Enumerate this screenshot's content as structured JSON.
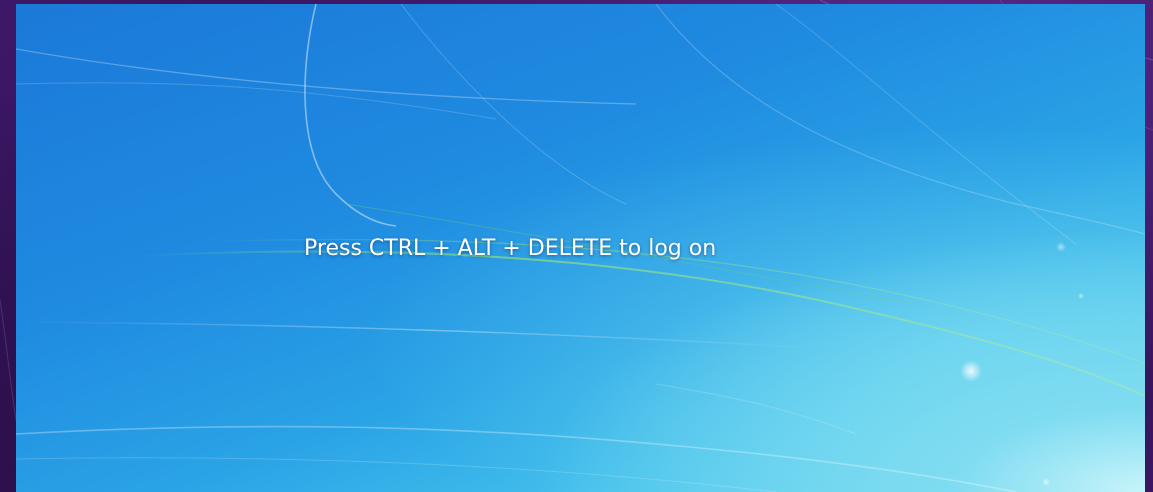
{
  "logon": {
    "prompt": "Press CTRL + ALT + DELETE to log on"
  },
  "colors": {
    "outer_frame": "#3a1660",
    "wallpaper_top": "#1b79d8",
    "wallpaper_bottom_right": "#c8f4fb",
    "prompt_text": "#ffffff"
  }
}
